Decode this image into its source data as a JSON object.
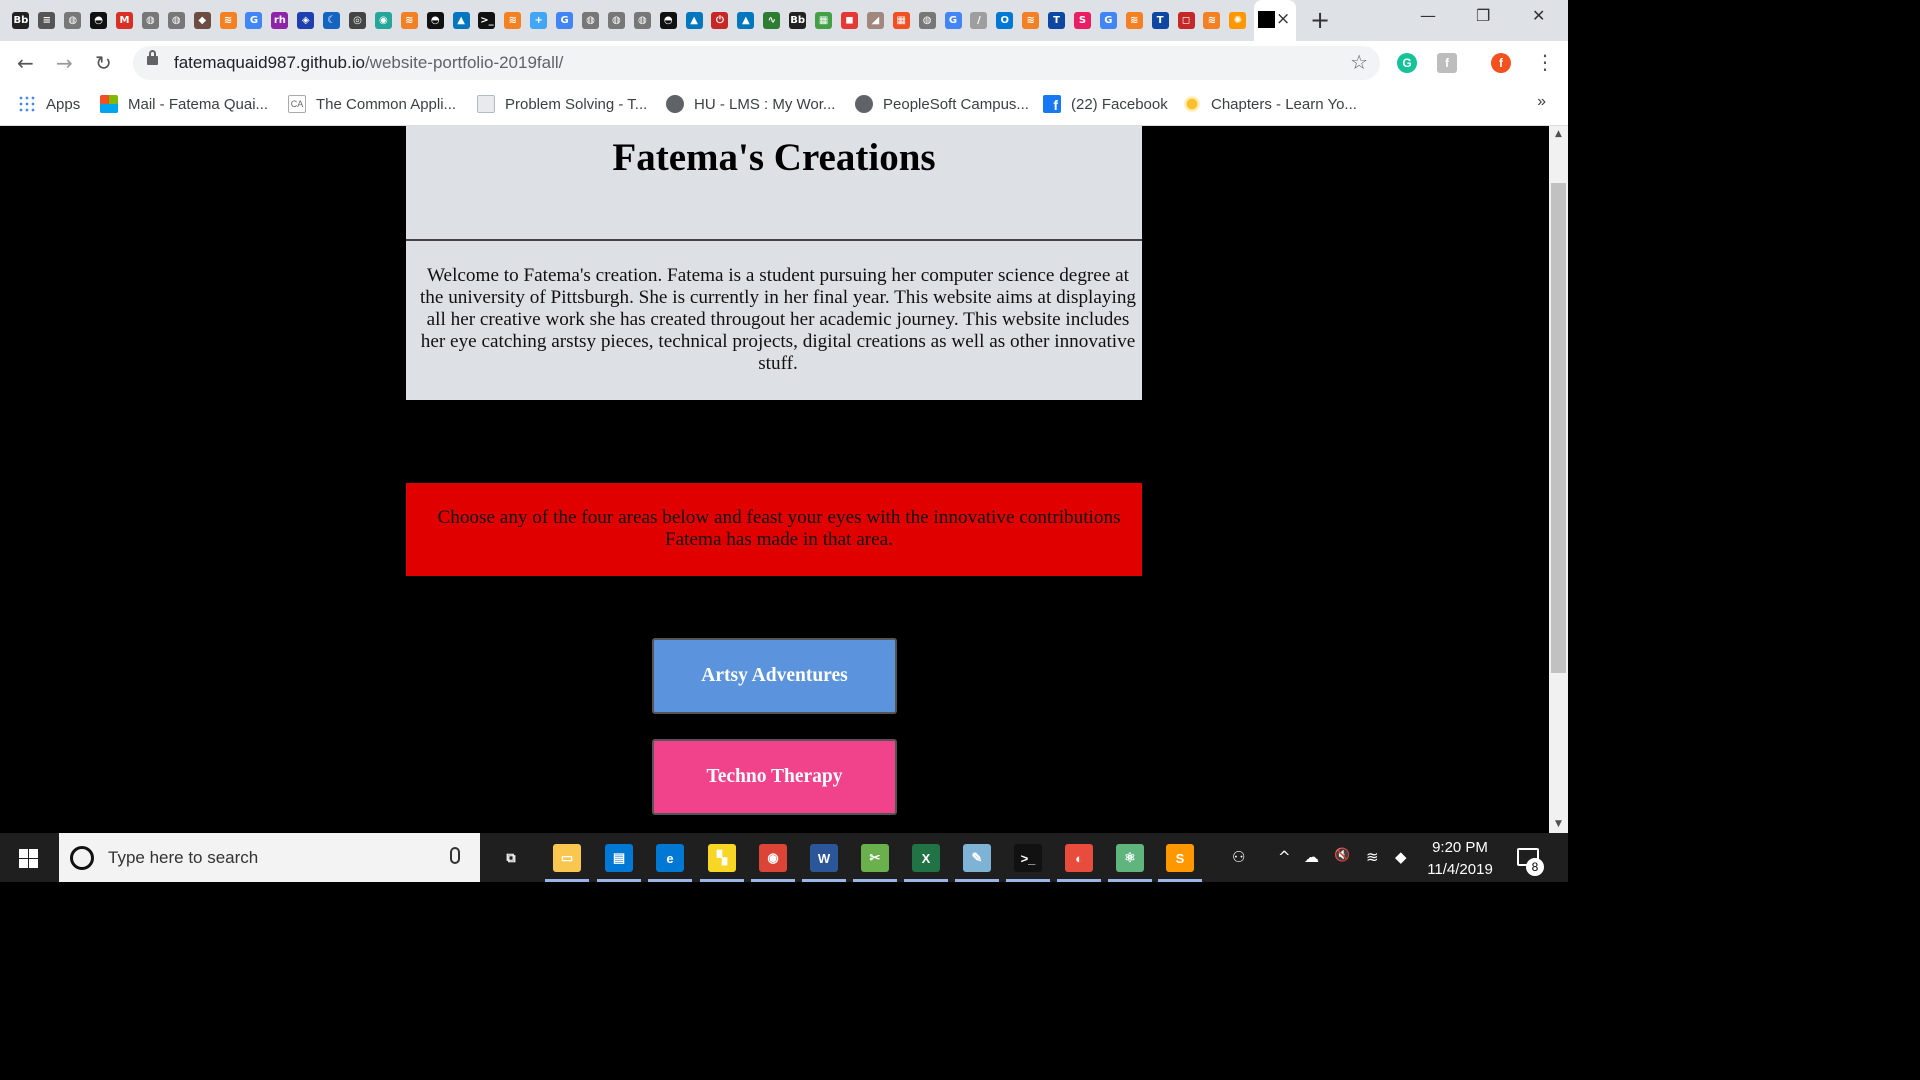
{
  "browser": {
    "address_domain": "fatemaquaid987.github.io",
    "address_path": "/website-portfolio-2019fall/",
    "active_tab_close": "×",
    "new_tab": "+",
    "minimize": "—",
    "restore": "❐",
    "close": "✕",
    "back": "←",
    "forward": "→",
    "reload": "↻",
    "star": "☆",
    "profile_initial": "f",
    "tab_favicons": [
      {
        "icon": "blackboard-icon",
        "color": "#222222",
        "label": "Bb"
      },
      {
        "icon": "document-icon",
        "color": "#555555",
        "label": "≡"
      },
      {
        "icon": "globe-icon",
        "color": "#777777",
        "label": "◍"
      },
      {
        "icon": "github-icon",
        "color": "#111111",
        "label": "◓"
      },
      {
        "icon": "gmail-icon",
        "color": "#d93025",
        "label": "M"
      },
      {
        "icon": "globe-icon",
        "color": "#777777",
        "label": "◍"
      },
      {
        "icon": "globe-icon",
        "color": "#777777",
        "label": "◍"
      },
      {
        "icon": "shield-icon",
        "color": "#6d4c41",
        "label": "◆"
      },
      {
        "icon": "stackoverflow-icon",
        "color": "#f48024",
        "label": "≋"
      },
      {
        "icon": "google-icon",
        "color": "#4285f4",
        "label": "G"
      },
      {
        "icon": "rh-icon",
        "color": "#8e24aa",
        "label": "rh"
      },
      {
        "icon": "codepen-icon",
        "color": "#1e40af",
        "label": "◈"
      },
      {
        "icon": "moon-icon",
        "color": "#1565c0",
        "label": "☾"
      },
      {
        "icon": "circle-icon",
        "color": "#444444",
        "label": "◎"
      },
      {
        "icon": "eye-icon",
        "color": "#26a69a",
        "label": "◉"
      },
      {
        "icon": "stackoverflow-icon",
        "color": "#f48024",
        "label": "≋"
      },
      {
        "icon": "github-icon",
        "color": "#111111",
        "label": "◓"
      },
      {
        "icon": "cap-icon",
        "color": "#0277bd",
        "label": "▲"
      },
      {
        "icon": "terminal-icon",
        "color": "#111111",
        "label": ">_"
      },
      {
        "icon": "stackoverflow-icon",
        "color": "#f48024",
        "label": "≋"
      },
      {
        "icon": "plus-icon",
        "color": "#42a5f5",
        "label": "+"
      },
      {
        "icon": "google-icon",
        "color": "#4285f4",
        "label": "G"
      },
      {
        "icon": "globe-icon",
        "color": "#777777",
        "label": "◍"
      },
      {
        "icon": "globe-icon",
        "color": "#777777",
        "label": "◍"
      },
      {
        "icon": "globe-icon",
        "color": "#777777",
        "label": "◍"
      },
      {
        "icon": "github-icon",
        "color": "#111111",
        "label": "◓"
      },
      {
        "icon": "cap-icon",
        "color": "#0277bd",
        "label": "▲"
      },
      {
        "icon": "power-icon",
        "color": "#c62828",
        "label": "⏻"
      },
      {
        "icon": "cap-icon",
        "color": "#0277bd",
        "label": "▲"
      },
      {
        "icon": "wave-icon",
        "color": "#2e7d32",
        "label": "∿"
      },
      {
        "icon": "blackboard-icon",
        "color": "#222222",
        "label": "Bb"
      },
      {
        "icon": "chart-icon",
        "color": "#43a047",
        "label": "▦"
      },
      {
        "icon": "logo-icon",
        "color": "#e53935",
        "label": "◼"
      },
      {
        "icon": "shape-icon",
        "color": "#a1887f",
        "label": "◢"
      },
      {
        "icon": "microsoft-icon",
        "color": "#f25022",
        "label": "▦"
      },
      {
        "icon": "globe-icon",
        "color": "#777777",
        "label": "◍"
      },
      {
        "icon": "google-icon",
        "color": "#4285f4",
        "label": "G"
      },
      {
        "icon": "slash-icon",
        "color": "#9e9e9e",
        "label": "/"
      },
      {
        "icon": "outlook-icon",
        "color": "#0078d4",
        "label": "O"
      },
      {
        "icon": "stackoverflow-icon",
        "color": "#f48024",
        "label": "≋"
      },
      {
        "icon": "t-icon",
        "color": "#0d47a1",
        "label": "T"
      },
      {
        "icon": "swirl-icon",
        "color": "#e91e63",
        "label": "S"
      },
      {
        "icon": "google-icon",
        "color": "#4285f4",
        "label": "G"
      },
      {
        "icon": "stackoverflow-icon",
        "color": "#f48024",
        "label": "≋"
      },
      {
        "icon": "t-icon",
        "color": "#0d47a1",
        "label": "T"
      },
      {
        "icon": "square-icon",
        "color": "#c62828",
        "label": "◻"
      },
      {
        "icon": "stackoverflow-icon",
        "color": "#f48024",
        "label": "≋"
      },
      {
        "icon": "sun-icon",
        "color": "#ff9800",
        "label": "✺"
      }
    ]
  },
  "bookmarks": {
    "items": [
      {
        "label": "Apps",
        "icon": "apps-grid-icon",
        "color": "#4285f4"
      },
      {
        "label": "Mail - Fatema Quai...",
        "icon": "microsoft-icon",
        "color": "#f25022"
      },
      {
        "label": "The Common Appli...",
        "icon": "commonapp-icon",
        "color": "#e0e0e0"
      },
      {
        "label": "Problem Solving - T...",
        "icon": "document-icon",
        "color": "#cfd8dc"
      },
      {
        "label": "HU - LMS : My Wor...",
        "icon": "globe-icon",
        "color": "#5f6368"
      },
      {
        "label": "PeopleSoft Campus...",
        "icon": "globe-icon",
        "color": "#5f6368"
      },
      {
        "label": "(22) Facebook",
        "icon": "facebook-icon",
        "color": "#1877f2"
      },
      {
        "label": "Chapters - Learn Yo...",
        "icon": "sun-icon",
        "color": "#fbc02d"
      }
    ],
    "more": "»"
  },
  "page": {
    "title": "Fatema's Creations",
    "welcome": "Welcome to Fatema's creation. Fatema is a student pursuing her computer science degree at the university of Pittsburgh. She is currently in her final year. This website aims at displaying all her creative work she has created througout her academic journey. This website includes her eye catching arstsy pieces, technical projects, digital creations as well as other innovative stuff.",
    "choose_text": "Choose any of the four areas below and feast your eyes with the innovative contributions Fatema has made in that area.",
    "buttons": [
      {
        "label": "Artsy Adventures",
        "color": "#5b94dc"
      },
      {
        "label": "Techno Therapy",
        "color": "#f0438b"
      }
    ],
    "colors": {
      "header_bg": "#dde0e5",
      "banner_bg": "#e00000",
      "page_bg": "#000000"
    }
  },
  "taskbar": {
    "search_placeholder": "Type here to search",
    "time": "9:20 PM",
    "date": "11/4/2019",
    "notification_count": "8",
    "apps": [
      {
        "icon": "task-view-icon",
        "color": "#1f1f1f",
        "label": "⧉"
      },
      {
        "icon": "file-explorer-icon",
        "color": "#f9c74f",
        "label": "▭"
      },
      {
        "icon": "store-icon",
        "color": "#0078d4",
        "label": "▤"
      },
      {
        "icon": "edge-icon",
        "color": "#0078d4",
        "label": "e"
      },
      {
        "icon": "sticky-notes-icon",
        "color": "#f7d723",
        "label": "▚"
      },
      {
        "icon": "chrome-icon",
        "color": "#db4437",
        "label": "◉"
      },
      {
        "icon": "word-icon",
        "color": "#2b579a",
        "label": "W"
      },
      {
        "icon": "snip-icon",
        "color": "#6ab04c",
        "label": "✂"
      },
      {
        "icon": "excel-icon",
        "color": "#217346",
        "label": "X"
      },
      {
        "icon": "notepad-icon",
        "color": "#7fb3d5",
        "label": "✎"
      },
      {
        "icon": "terminal-icon",
        "color": "#111111",
        "label": ">_"
      },
      {
        "icon": "paint-icon",
        "color": "#e74c3c",
        "label": "◐"
      },
      {
        "icon": "atom-icon",
        "color": "#5fb57d",
        "label": "⚛"
      },
      {
        "icon": "sublime-icon",
        "color": "#ff9800",
        "label": "S"
      }
    ],
    "tray": {
      "people": "⚇",
      "chevron": "^",
      "onedrive": "☁",
      "volume": "🔇",
      "wifi": "≋",
      "dropbox": "◆"
    }
  }
}
